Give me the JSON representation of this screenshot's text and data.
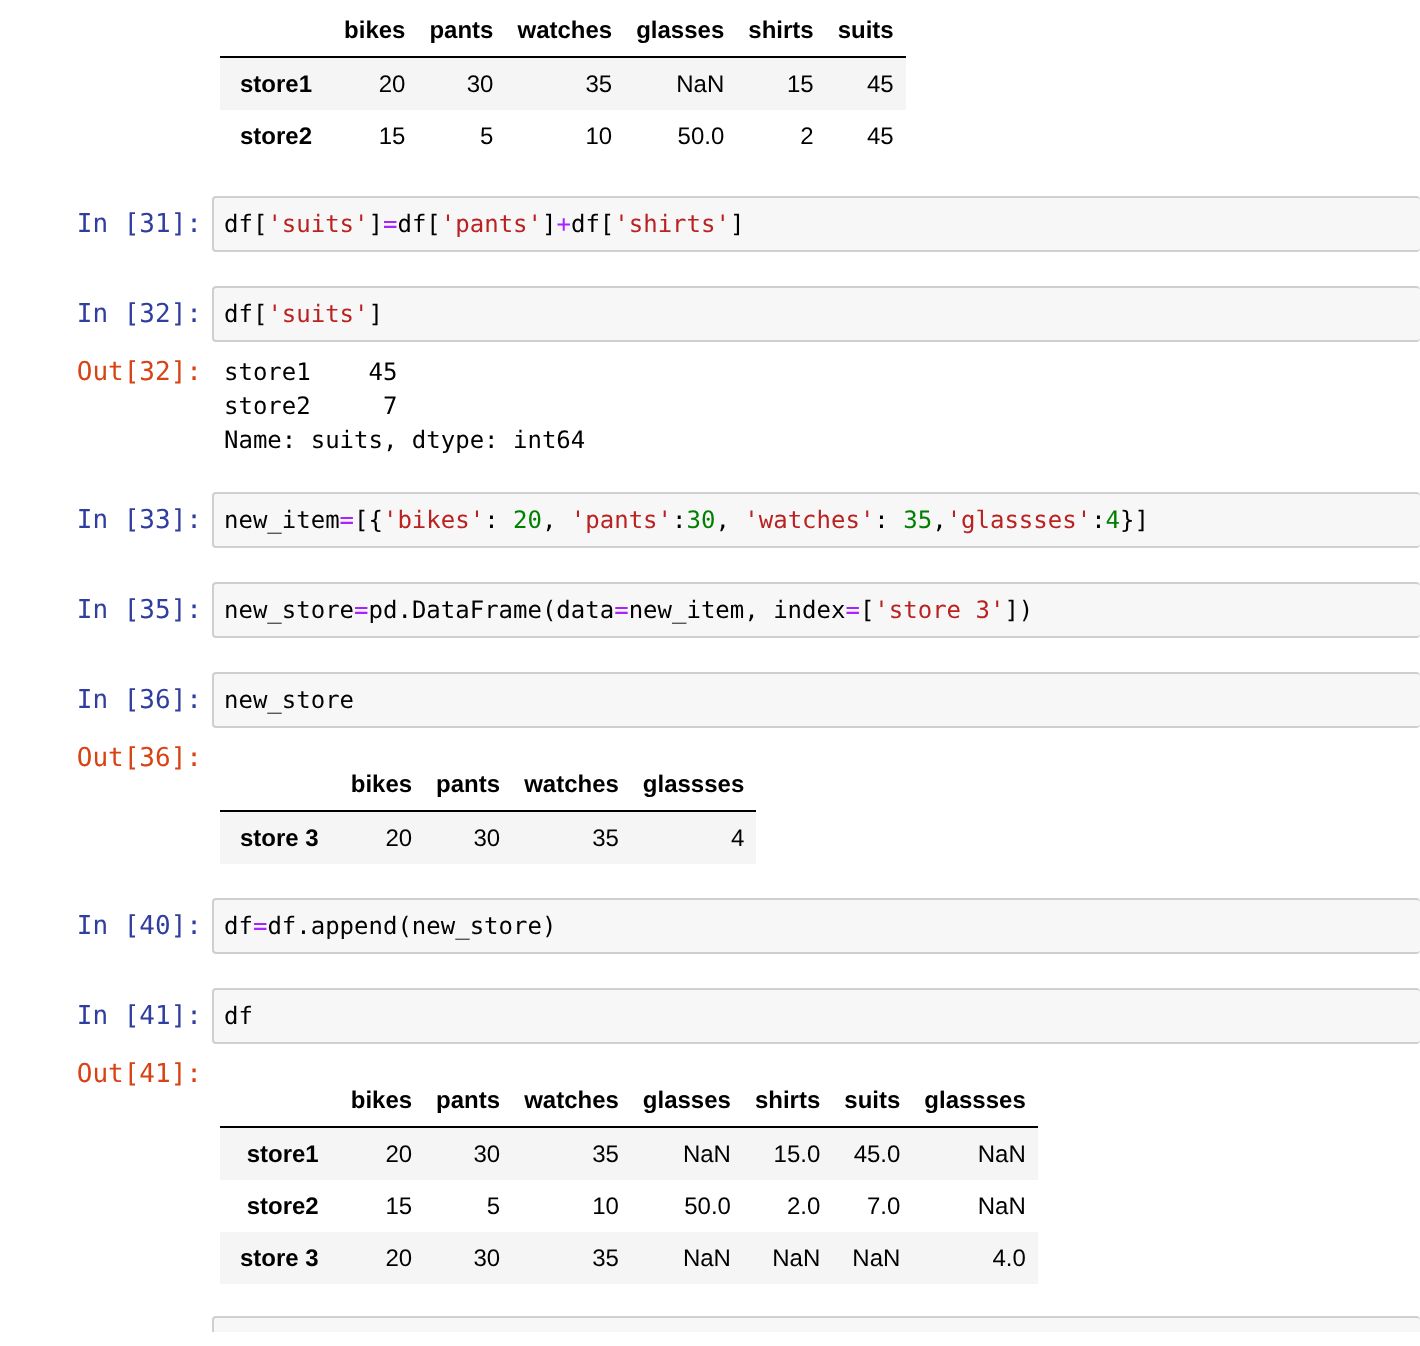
{
  "cells": [
    {
      "kind": "table_output",
      "table": {
        "columns": [
          "bikes",
          "pants",
          "watches",
          "glasses",
          "shirts",
          "suits"
        ],
        "rows": [
          {
            "index": "store1",
            "values": [
              "20",
              "30",
              "35",
              "NaN",
              "15",
              "45"
            ]
          },
          {
            "index": "store2",
            "values": [
              "15",
              "5",
              "10",
              "50.0",
              "2",
              "45"
            ]
          }
        ]
      }
    },
    {
      "kind": "input",
      "prompt": "In [31]:",
      "code": [
        {
          "t": "df[",
          "kind": "plain"
        },
        {
          "t": "'suits'",
          "kind": "string"
        },
        {
          "t": "]",
          "kind": "plain"
        },
        {
          "t": "=",
          "kind": "op"
        },
        {
          "t": "df[",
          "kind": "plain"
        },
        {
          "t": "'pants'",
          "kind": "string"
        },
        {
          "t": "]",
          "kind": "plain"
        },
        {
          "t": "+",
          "kind": "op"
        },
        {
          "t": "df[",
          "kind": "plain"
        },
        {
          "t": "'shirts'",
          "kind": "string"
        },
        {
          "t": "]",
          "kind": "plain"
        }
      ]
    },
    {
      "kind": "input",
      "prompt": "In [32]:",
      "code": [
        {
          "t": "df[",
          "kind": "plain"
        },
        {
          "t": "'suits'",
          "kind": "string"
        },
        {
          "t": "]",
          "kind": "plain"
        }
      ]
    },
    {
      "kind": "text_output",
      "prompt": "Out[32]:",
      "lines": [
        "store1    45",
        "store2     7",
        "Name: suits, dtype: int64"
      ]
    },
    {
      "kind": "input",
      "prompt": "In [33]:",
      "code": [
        {
          "t": "new_item",
          "kind": "plain"
        },
        {
          "t": "=",
          "kind": "op"
        },
        {
          "t": "[{",
          "kind": "plain"
        },
        {
          "t": "'bikes'",
          "kind": "string"
        },
        {
          "t": ": ",
          "kind": "plain"
        },
        {
          "t": "20",
          "kind": "number"
        },
        {
          "t": ", ",
          "kind": "plain"
        },
        {
          "t": "'pants'",
          "kind": "string"
        },
        {
          "t": ":",
          "kind": "plain"
        },
        {
          "t": "30",
          "kind": "number"
        },
        {
          "t": ", ",
          "kind": "plain"
        },
        {
          "t": "'watches'",
          "kind": "string"
        },
        {
          "t": ": ",
          "kind": "plain"
        },
        {
          "t": "35",
          "kind": "number"
        },
        {
          "t": ",",
          "kind": "plain"
        },
        {
          "t": "'glassses'",
          "kind": "string"
        },
        {
          "t": ":",
          "kind": "plain"
        },
        {
          "t": "4",
          "kind": "number"
        },
        {
          "t": "}]",
          "kind": "plain"
        }
      ]
    },
    {
      "kind": "input",
      "prompt": "In [35]:",
      "code": [
        {
          "t": "new_store",
          "kind": "plain"
        },
        {
          "t": "=",
          "kind": "op"
        },
        {
          "t": "pd.DataFrame(data",
          "kind": "plain"
        },
        {
          "t": "=",
          "kind": "op"
        },
        {
          "t": "new_item, index",
          "kind": "plain"
        },
        {
          "t": "=",
          "kind": "op"
        },
        {
          "t": "[",
          "kind": "plain"
        },
        {
          "t": "'store 3'",
          "kind": "string"
        },
        {
          "t": "])",
          "kind": "plain"
        }
      ]
    },
    {
      "kind": "input",
      "prompt": "In [36]:",
      "code": [
        {
          "t": "new_store",
          "kind": "plain"
        }
      ]
    },
    {
      "kind": "table_output",
      "prompt": "Out[36]:",
      "table": {
        "columns": [
          "bikes",
          "pants",
          "watches",
          "glassses"
        ],
        "rows": [
          {
            "index": "store 3",
            "values": [
              "20",
              "30",
              "35",
              "4"
            ]
          }
        ]
      }
    },
    {
      "kind": "input",
      "prompt": "In [40]:",
      "code": [
        {
          "t": "df",
          "kind": "plain"
        },
        {
          "t": "=",
          "kind": "op"
        },
        {
          "t": "df.append(new_store)",
          "kind": "plain"
        }
      ]
    },
    {
      "kind": "input",
      "prompt": "In [41]:",
      "code": [
        {
          "t": "df",
          "kind": "plain"
        }
      ]
    },
    {
      "kind": "table_output",
      "prompt": "Out[41]:",
      "table": {
        "columns": [
          "bikes",
          "pants",
          "watches",
          "glasses",
          "shirts",
          "suits",
          "glassses"
        ],
        "rows": [
          {
            "index": "store1",
            "values": [
              "20",
              "30",
              "35",
              "NaN",
              "15.0",
              "45.0",
              "NaN"
            ]
          },
          {
            "index": "store2",
            "values": [
              "15",
              "5",
              "10",
              "50.0",
              "2.0",
              "7.0",
              "NaN"
            ]
          },
          {
            "index": "store 3",
            "values": [
              "20",
              "30",
              "35",
              "NaN",
              "NaN",
              "NaN",
              "4.0"
            ]
          }
        ]
      }
    },
    {
      "kind": "empty_input"
    }
  ]
}
